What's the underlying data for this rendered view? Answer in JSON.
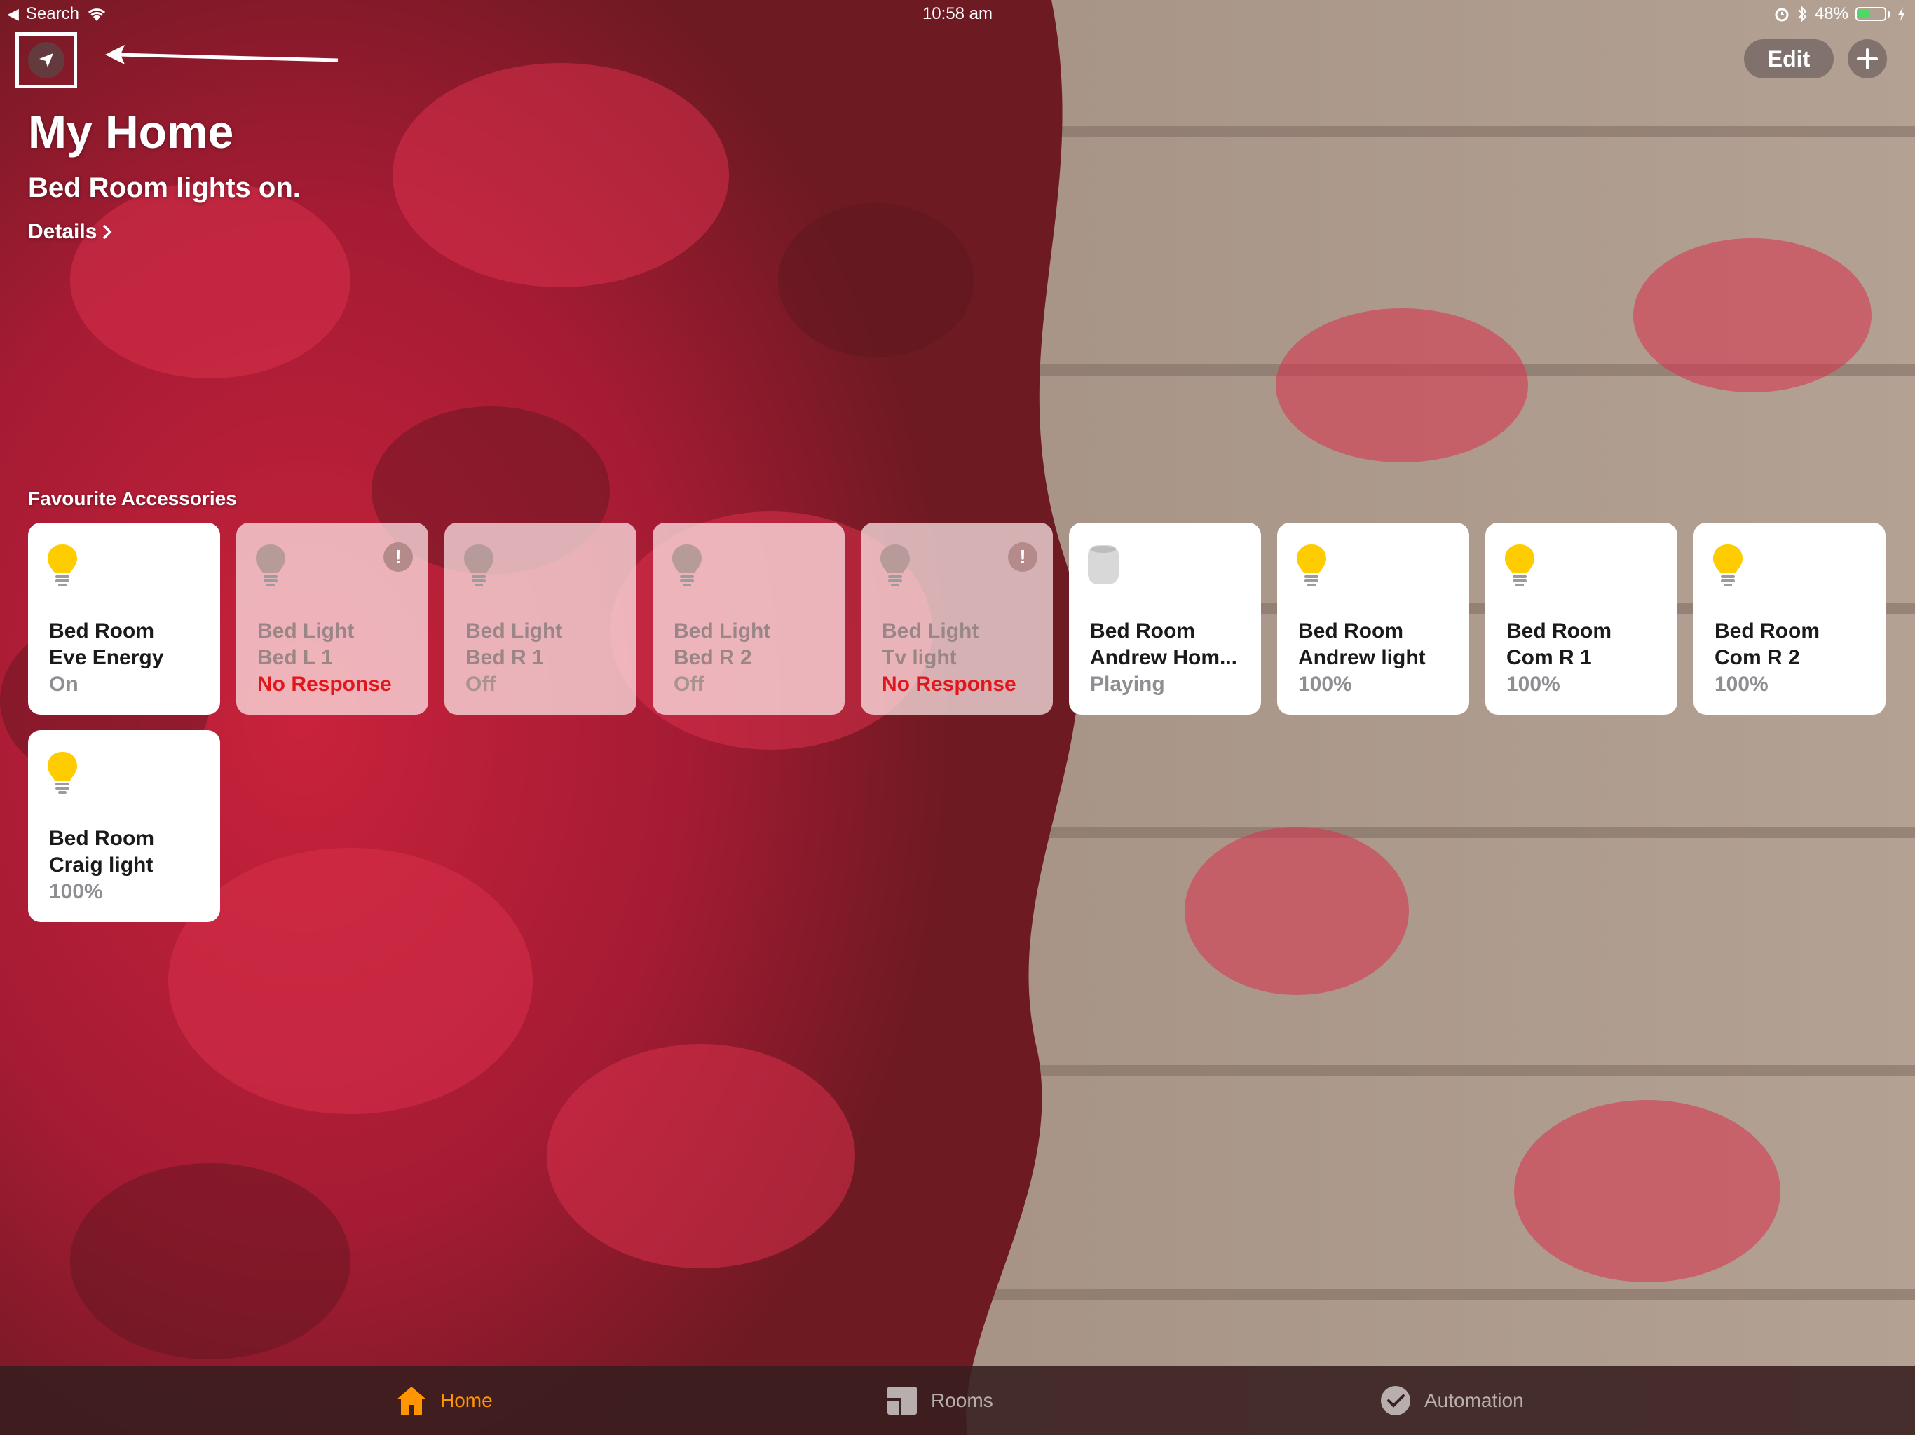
{
  "status_bar": {
    "back_label": "Search",
    "time": "10:58 am",
    "battery": "48%",
    "battery_level": 0.48
  },
  "colors": {
    "accent": "#ff9500",
    "bulb_on": "#ffcc00",
    "error": "#e0181e"
  },
  "toolbar": {
    "location_icon": "location-arrow-icon",
    "edit_label": "Edit",
    "add_icon": "plus-icon"
  },
  "header": {
    "title": "My Home",
    "status": "Bed Room lights on.",
    "details_label": "Details"
  },
  "favourites": {
    "section_title": "Favourite Accessories",
    "tiles": [
      {
        "room": "Bed Room",
        "name": "Eve Energy",
        "state": "On",
        "on": true,
        "icon": "lightbulb-icon",
        "alert": false,
        "error": false
      },
      {
        "room": "Bed Light",
        "name": "Bed L 1",
        "state": "No Response",
        "on": false,
        "icon": "lightbulb-icon",
        "alert": true,
        "error": true
      },
      {
        "room": "Bed Light",
        "name": "Bed R 1",
        "state": "Off",
        "on": false,
        "icon": "lightbulb-icon",
        "alert": false,
        "error": false
      },
      {
        "room": "Bed Light",
        "name": "Bed R 2",
        "state": "Off",
        "on": false,
        "icon": "lightbulb-icon",
        "alert": false,
        "error": false
      },
      {
        "room": "Bed Light",
        "name": "Tv light",
        "state": "No Response",
        "on": false,
        "icon": "lightbulb-icon",
        "alert": true,
        "error": true
      },
      {
        "room": "Bed Room",
        "name": "Andrew Hom...",
        "state": "Playing",
        "on": true,
        "icon": "homepod-icon",
        "alert": false,
        "error": false
      },
      {
        "room": "Bed Room",
        "name": "Andrew light",
        "state": "100%",
        "on": true,
        "icon": "lightbulb-icon",
        "alert": false,
        "error": false
      },
      {
        "room": "Bed Room",
        "name": "Com R 1",
        "state": "100%",
        "on": true,
        "icon": "lightbulb-icon",
        "alert": false,
        "error": false
      },
      {
        "room": "Bed Room",
        "name": "Com R 2",
        "state": "100%",
        "on": true,
        "icon": "lightbulb-icon",
        "alert": false,
        "error": false
      },
      {
        "room": "Bed Room",
        "name": "Craig light",
        "state": "100%",
        "on": true,
        "icon": "lightbulb-icon",
        "alert": false,
        "error": false
      }
    ]
  },
  "tabbar": {
    "tabs": [
      {
        "label": "Home",
        "icon": "house-icon",
        "active": true
      },
      {
        "label": "Rooms",
        "icon": "rooms-icon",
        "active": false
      },
      {
        "label": "Automation",
        "icon": "automation-icon",
        "active": false
      }
    ]
  }
}
